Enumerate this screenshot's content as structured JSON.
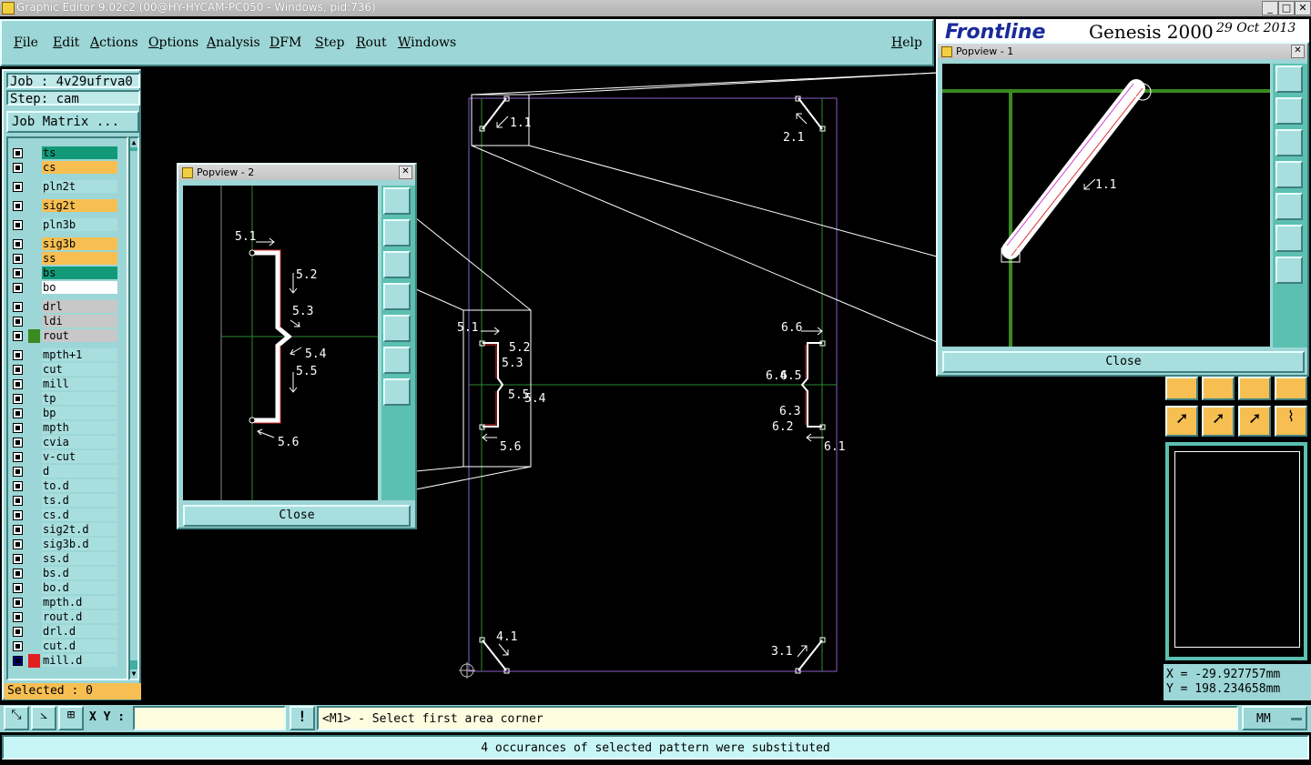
{
  "window_title": "Graphic Editor 9.02c2 (00@HY-HYCAM-PC050 - Windows, pid:736)",
  "menu": [
    "File",
    "Edit",
    "Actions",
    "Options",
    "Analysis",
    "DFM",
    "Step",
    "Rout",
    "Windows"
  ],
  "help_label": "Help",
  "brand": {
    "logo_text": "Frontline",
    "product": "Genesis 2000",
    "date": "29 Oct 2013"
  },
  "job": {
    "job_label": "Job : 4v29ufrva0",
    "step_label": "Step: cam",
    "matrix_button": "Job Matrix ..."
  },
  "layers": [
    {
      "name": "ts",
      "color": "#129a78"
    },
    {
      "name": "cs",
      "color": "#f7bf52"
    },
    {
      "name": "pln2t",
      "color": "#9cd6d6"
    },
    {
      "name": "sig2t",
      "color": "#f7bf52"
    },
    {
      "name": "pln3b",
      "color": "#9cd6d6"
    },
    {
      "name": "sig3b",
      "color": "#f7bf52"
    },
    {
      "name": "ss",
      "color": "#f7bf52"
    },
    {
      "name": "bs",
      "color": "#129a78"
    },
    {
      "name": "bo",
      "color": "#ffffff"
    },
    {
      "name": "drl",
      "color": "#c8c8c8"
    },
    {
      "name": "ldi",
      "color": "#c8c8c8"
    },
    {
      "name": "rout",
      "color": "#c8c8c8"
    },
    {
      "name": "mpth+1",
      "color": "#9cd6d6"
    },
    {
      "name": "cut",
      "color": "#9cd6d6"
    },
    {
      "name": "mill",
      "color": "#9cd6d6"
    },
    {
      "name": "tp",
      "color": "#9cd6d6"
    },
    {
      "name": "bp",
      "color": "#9cd6d6"
    },
    {
      "name": "mpth",
      "color": "#9cd6d6"
    },
    {
      "name": "cvia",
      "color": "#9cd6d6"
    },
    {
      "name": "v-cut",
      "color": "#9cd6d6"
    },
    {
      "name": "d",
      "color": "#9cd6d6"
    },
    {
      "name": "to.d",
      "color": "#9cd6d6"
    },
    {
      "name": "ts.d",
      "color": "#9cd6d6"
    },
    {
      "name": "cs.d",
      "color": "#9cd6d6"
    },
    {
      "name": "sig2t.d",
      "color": "#9cd6d6"
    },
    {
      "name": "sig3b.d",
      "color": "#9cd6d6"
    },
    {
      "name": "ss.d",
      "color": "#9cd6d6"
    },
    {
      "name": "bs.d",
      "color": "#9cd6d6"
    },
    {
      "name": "bo.d",
      "color": "#9cd6d6"
    },
    {
      "name": "mpth.d",
      "color": "#9cd6d6"
    },
    {
      "name": "rout.d",
      "color": "#9cd6d6"
    },
    {
      "name": "drl.d",
      "color": "#9cd6d6"
    },
    {
      "name": "cut.d",
      "color": "#9cd6d6"
    },
    {
      "name": "mill.d",
      "color": "#9cd6d6"
    }
  ],
  "selected_label": "Selected : 0",
  "popview2": {
    "title": "Popview - 2",
    "close": "Close",
    "labels": {
      "a": "5.1",
      "b": "5.2",
      "c": "5.3",
      "d": "5.4",
      "e": "5.5",
      "f": "5.6"
    }
  },
  "popview1": {
    "title": "Popview - 1",
    "close": "Close",
    "label": "1.1"
  },
  "canvas_labels": {
    "l11": "1.1",
    "l21": "2.1",
    "l31": "3.1",
    "l41": "4.1",
    "l51": "5.1",
    "l52": "5.2",
    "l53": "5.3",
    "l54": "5.4",
    "l55": "5.5",
    "l56": "5.6",
    "l61": "6.1",
    "l62": "6.2",
    "l63": "6.3",
    "l64": "6.4",
    "l65": "6.5",
    "l66": "6.6"
  },
  "coords": {
    "x": "X = -29.927757mm",
    "y": "Y = 198.234658mm"
  },
  "xy_label": "X Y :",
  "prompt": "<M1> - Select first area corner",
  "units": "MM",
  "message": "4 occurances of selected pattern were substituted"
}
